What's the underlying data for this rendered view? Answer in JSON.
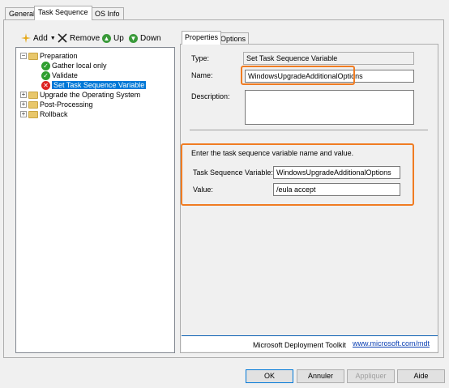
{
  "tabs": [
    {
      "label": "General"
    },
    {
      "label": "Task Sequence"
    },
    {
      "label": "OS Info"
    }
  ],
  "toolbar": {
    "add": "Add",
    "remove": "Remove",
    "up": "Up",
    "down": "Down"
  },
  "tree": {
    "items": [
      {
        "label": "Preparation",
        "expander": "−",
        "icon": "folder-icon"
      },
      {
        "label": "Gather local only",
        "icon": "check-icon"
      },
      {
        "label": "Validate",
        "icon": "check-icon"
      },
      {
        "label": "Set Task Sequence Variable",
        "icon": "error-icon",
        "selected": true
      },
      {
        "label": "Upgrade the Operating System",
        "expander": "+",
        "icon": "folder-icon"
      },
      {
        "label": "Post-Processing",
        "expander": "+",
        "icon": "folder-icon"
      },
      {
        "label": "Rollback",
        "expander": "+",
        "icon": "folder-icon"
      }
    ]
  },
  "right_tabs": [
    {
      "label": "Properties"
    },
    {
      "label": "Options"
    }
  ],
  "properties": {
    "type_label": "Type:",
    "type_value": "Set Task Sequence Variable",
    "name_label": "Name:",
    "name_value": "WindowsUpgradeAdditionalOptions",
    "description_label": "Description:",
    "description_value": "",
    "instruction": "Enter the task sequence variable name and value.",
    "tsv_label": "Task Sequence Variable:",
    "tsv_value": "WindowsUpgradeAdditionalOptions",
    "value_label": "Value:",
    "value_value": "/eula accept"
  },
  "footer": {
    "brand": "Microsoft Deployment Toolkit",
    "link": "www.microsoft.com/mdt"
  },
  "buttons": {
    "ok": "OK",
    "cancel": "Annuler",
    "apply": "Appliquer",
    "help": "Aide"
  },
  "colors": {
    "highlight_box": "#f07c22",
    "selection": "#0078d7"
  }
}
